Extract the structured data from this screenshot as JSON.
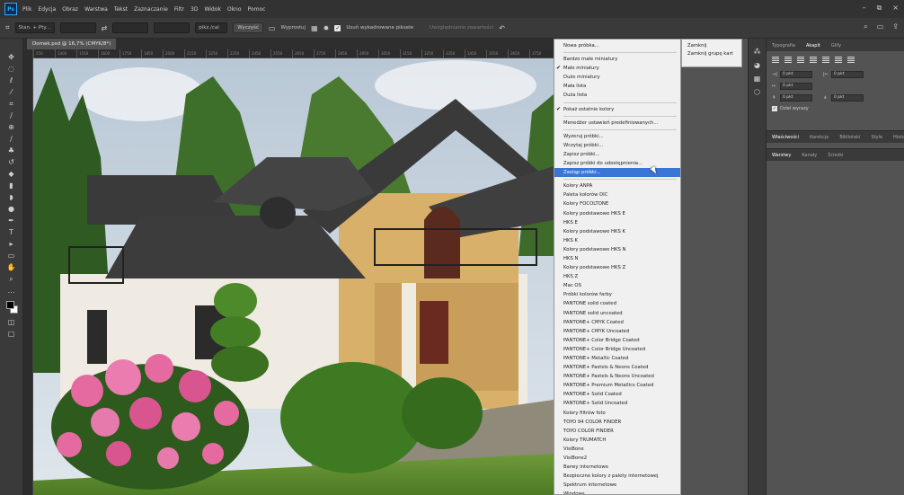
{
  "menubar": {
    "logo": "Ps",
    "items": [
      "Plik",
      "Edycja",
      "Obraz",
      "Warstwa",
      "Tekst",
      "Zaznaczanie",
      "Filtr",
      "3D",
      "Widok",
      "Okno",
      "Pomoc"
    ],
    "controls": [
      "–",
      "⧉",
      "×"
    ]
  },
  "options": {
    "mode": "Stan. + Pty...",
    "unit": "pikz./cal",
    "clear": "Wyczyść",
    "straighten": "Wyprostuj",
    "delete_cropped": "Usuń wykadrowane piksele",
    "content_aware": "Uwzględnianie zawartości"
  },
  "document": {
    "tab_title": "Domek.psd @ 16,7% (CMYK/8*)",
    "ruler_ticks": [
      "250",
      "1400",
      "1550",
      "1600",
      "1750",
      "1850",
      "2000",
      "2150",
      "2250",
      "2350",
      "2450",
      "2550",
      "2650",
      "2750",
      "2850",
      "2950",
      "3050",
      "3150",
      "3250",
      "3350",
      "3450",
      "3550",
      "3650",
      "3750"
    ]
  },
  "flyout": {
    "items": [
      {
        "label": "Nowa próbka...",
        "checked": false,
        "sep_after": true
      },
      {
        "label": "Bardzo małe miniatury",
        "checked": false
      },
      {
        "label": "Małe miniatury",
        "checked": true
      },
      {
        "label": "Duże miniatury",
        "checked": false
      },
      {
        "label": "Mała lista",
        "checked": false
      },
      {
        "label": "Duża lista",
        "checked": false,
        "sep_after": true
      },
      {
        "label": "Pokaż ostatnie kolory",
        "checked": true,
        "sep_after": true
      },
      {
        "label": "Menedżer ustawień predefiniowanych...",
        "checked": false,
        "sep_after": true
      },
      {
        "label": "Wyzeruj próbki...",
        "checked": false
      },
      {
        "label": "Wczytaj próbki...",
        "checked": false
      },
      {
        "label": "Zapisz próbki...",
        "checked": false
      },
      {
        "label": "Zapisz próbki do udostępnienia...",
        "checked": false
      },
      {
        "label": "Zastąp próbki...",
        "checked": false,
        "highlighted": true,
        "sep_after": true
      },
      {
        "label": "Kolory ANPA",
        "checked": false
      },
      {
        "label": "Paleta kolorów DIC",
        "checked": false
      },
      {
        "label": "Kolory FOCOLTONE",
        "checked": false
      },
      {
        "label": "Kolory podstawowe HKS E",
        "checked": false
      },
      {
        "label": "HKS E",
        "checked": false
      },
      {
        "label": "Kolory podstawowe HKS K",
        "checked": false
      },
      {
        "label": "HKS K",
        "checked": false
      },
      {
        "label": "Kolory podstawowe HKS N",
        "checked": false
      },
      {
        "label": "HKS N",
        "checked": false
      },
      {
        "label": "Kolory podstawowe HKS Z",
        "checked": false
      },
      {
        "label": "HKS Z",
        "checked": false
      },
      {
        "label": "Mac OS",
        "checked": false
      },
      {
        "label": "Próbki kolorów farby",
        "checked": false
      },
      {
        "label": "PANTONE solid coated",
        "checked": false
      },
      {
        "label": "PANTONE solid uncoated",
        "checked": false
      },
      {
        "label": "PANTONE+ CMYK Coated",
        "checked": false
      },
      {
        "label": "PANTONE+ CMYK Uncoated",
        "checked": false
      },
      {
        "label": "PANTONE+ Color Bridge Coated",
        "checked": false
      },
      {
        "label": "PANTONE+ Color Bridge Uncoated",
        "checked": false
      },
      {
        "label": "PANTONE+ Metallic Coated",
        "checked": false
      },
      {
        "label": "PANTONE+ Pastels & Neons Coated",
        "checked": false
      },
      {
        "label": "PANTONE+ Pastels & Neons Uncoated",
        "checked": false
      },
      {
        "label": "PANTONE+ Premium Metallics Coated",
        "checked": false
      },
      {
        "label": "PANTONE+ Solid Coated",
        "checked": false
      },
      {
        "label": "PANTONE+ Solid Uncoated",
        "checked": false
      },
      {
        "label": "Kolory filtrów foto",
        "checked": false
      },
      {
        "label": "TOYO 94 COLOR FINDER",
        "checked": false
      },
      {
        "label": "TOYO COLOR FINDER",
        "checked": false
      },
      {
        "label": "Kolory TRUMATCH",
        "checked": false
      },
      {
        "label": "VisiBone",
        "checked": false
      },
      {
        "label": "VisiBone2",
        "checked": false
      },
      {
        "label": "Barwy internetowe",
        "checked": false
      },
      {
        "label": "Bezpieczne kolory z palety internetowej",
        "checked": false
      },
      {
        "label": "Spektrum internetowe",
        "checked": false
      },
      {
        "label": "Windows",
        "checked": false
      }
    ]
  },
  "flyout2": {
    "items": [
      "Zamknij",
      "Zamknij grupę kart"
    ]
  },
  "panels": {
    "top_tabs": [
      "Typografia",
      "Akapit",
      "Glify"
    ],
    "fields": [
      {
        "icon": "→|",
        "value": "0 pkt"
      },
      {
        "icon": "|←",
        "value": "0 pkt"
      },
      {
        "icon": "↦",
        "value": "0 pkt"
      },
      {
        "icon": "↟",
        "value": "0 pkt"
      },
      {
        "icon": "↡",
        "value": "0 pkt"
      }
    ],
    "hyphenate": "Dziel wyrazy",
    "mid_tabs": [
      "Właściwości",
      "Korekcje",
      "Biblioteki",
      "Style",
      "Historia"
    ],
    "low_tabs": [
      "Warstwy",
      "Kanały",
      "Ścieżki"
    ]
  },
  "colors": {
    "highlight": "#3a76d6",
    "menu_bg": "#f0f0f0",
    "ui_dark": "#323232",
    "ui_mid": "#535353"
  }
}
